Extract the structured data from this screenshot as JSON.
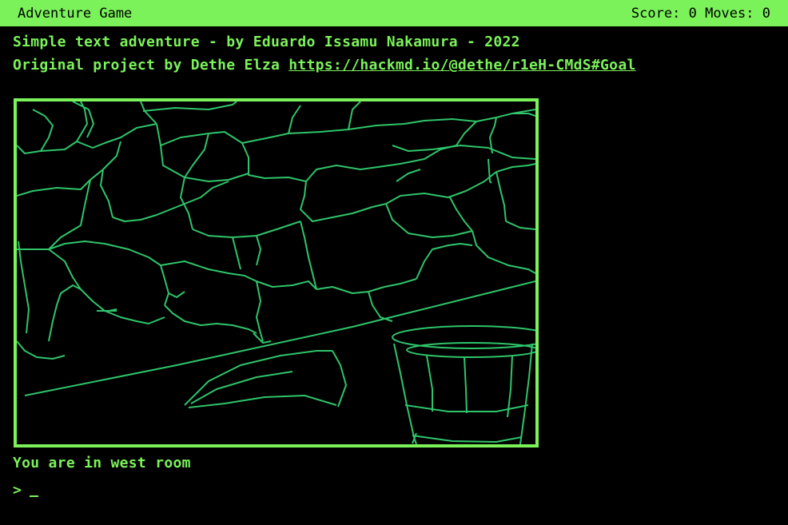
{
  "header": {
    "title": "Adventure Game",
    "score_label": "Score:",
    "score": "0",
    "moves_label": "Moves:",
    "moves": "0"
  },
  "intro": {
    "line1": "Simple text adventure - by Eduardo Issamu Nakamura - 2022",
    "line2_prefix": "Original project by Dethe Elza ",
    "link_text": "https://hackmd.io/@dethe/r1eH-CMdS#Goal"
  },
  "status": "You are in west room",
  "prompt": {
    "symbol": ">"
  },
  "colors": {
    "accent": "#7CF25A",
    "scene_line": "#2FC46A",
    "background": "#000000"
  }
}
